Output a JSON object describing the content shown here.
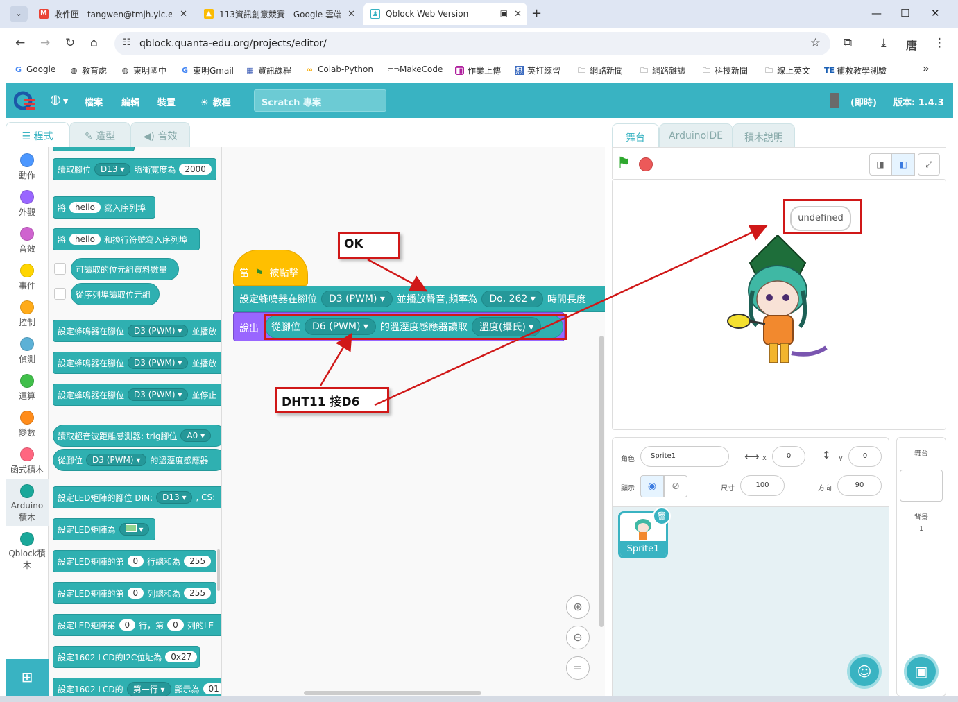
{
  "browser": {
    "tabs": [
      {
        "label": "收件匣 - tangwen@tmjh.ylc.ec"
      },
      {
        "label": "113資訊創意競賽 - Google 雲端"
      },
      {
        "label": "Qblock Web Version"
      }
    ],
    "url": "qblock.quanta-edu.org/projects/editor/",
    "profile": "唐",
    "bookmarks": [
      "Google",
      "教育處",
      "東明國中",
      "東明Gmail",
      "資訊課程",
      "Colab-Python",
      "MakeCode",
      "作業上傳",
      "英打練習",
      "網路新聞",
      "網路雜誌",
      "科技新聞",
      "線上英文",
      "補救教學測驗"
    ],
    "more": "»"
  },
  "qblock": {
    "menu": [
      "檔案",
      "編輯",
      "裝置",
      "教程"
    ],
    "project_name": "Scratch 專案",
    "mode": "(即時)",
    "version": "版本: 1.4.3",
    "editor_tabs": [
      "程式",
      "造型",
      "音效"
    ],
    "categories": [
      {
        "label": "動作",
        "color": "#4c97ff"
      },
      {
        "label": "外觀",
        "color": "#9966ff"
      },
      {
        "label": "音效",
        "color": "#cf63cf"
      },
      {
        "label": "事件",
        "color": "#ffd500"
      },
      {
        "label": "控制",
        "color": "#ffab19"
      },
      {
        "label": "偵測",
        "color": "#5cb1d6"
      },
      {
        "label": "運算",
        "color": "#40bf4a"
      },
      {
        "label": "變數",
        "color": "#ff8c1a"
      },
      {
        "label": "函式積木",
        "color": "#ff6680"
      },
      {
        "label": "Arduino積木",
        "color": "#1aa89a"
      },
      {
        "label": "Qblock積木",
        "color": "#1aa89a"
      }
    ],
    "palette": {
      "b1": {
        "pre": "讀取腳位",
        "pin": "D13",
        "mid": "脈衝寬度為",
        "val": "2000"
      },
      "b2": {
        "pre": "將",
        "pill": "hello",
        "post": "寫入序列埠"
      },
      "b3": {
        "pre": "將",
        "pill": "hello",
        "post": "和換行符號寫入序列埠"
      },
      "b4": {
        "text": "可讀取的位元組資料數量"
      },
      "b5": {
        "text": "從序列埠讀取位元組"
      },
      "b6": {
        "pre": "設定蜂鳴器在腳位",
        "pin": "D3 (PWM)",
        "post": "並播放"
      },
      "b7": {
        "pre": "設定蜂鳴器在腳位",
        "pin": "D3 (PWM)",
        "post": "並播放"
      },
      "b8": {
        "pre": "設定蜂鳴器在腳位",
        "pin": "D3 (PWM)",
        "post": "並停止"
      },
      "b9": {
        "pre": "讀取超音波距離感測器: trig腳位",
        "pin": "A0"
      },
      "b10": {
        "pre": "從腳位",
        "pin": "D3 (PWM)",
        "post": "的溫溼度感應器"
      },
      "b11": {
        "pre": "設定LED矩陣的腳位 DIN:",
        "pin": "D13",
        "post": ", CS:"
      },
      "b12": {
        "pre": "設定LED矩陣為"
      },
      "b13": {
        "pre": "設定LED矩陣的第",
        "v1": "0",
        "mid": "行總和為",
        "v2": "255"
      },
      "b14": {
        "pre": "設定LED矩陣的第",
        "v1": "0",
        "mid": "列總和為",
        "v2": "255"
      },
      "b15": {
        "pre": "設定LED矩陣第",
        "v1": "0",
        "mid": "行，第",
        "v2": "0",
        "post": "列的LE"
      },
      "b16": {
        "pre": "設定1602 LCD的I2C位址為",
        "val": "0x27"
      },
      "b17": {
        "pre": "設定1602 LCD的",
        "dd": "第一行",
        "post": "顯示為",
        "val": "01"
      }
    },
    "script": {
      "hat_pre": "當",
      "hat_post": "被點擊",
      "buzzer_pre": "設定蜂鳴器在腳位",
      "buzzer_pin": "D3 (PWM)",
      "buzzer_mid": "並播放聲音,頻率為",
      "buzzer_note": "Do, 262",
      "buzzer_post": "時間長度",
      "say": "說出",
      "dht_pre": "從腳位",
      "dht_pin": "D6 (PWM)",
      "dht_mid": "的溫溼度感應器讀取",
      "dht_sel": "溫度(攝氏)"
    },
    "annotations": {
      "ok": "OK",
      "dht": "DHT11 接D6"
    },
    "right_tabs": [
      "舞台",
      "ArduinoIDE",
      "積木說明"
    ],
    "speech": "undefined",
    "sprite": {
      "role_label": "角色",
      "name": "Sprite1",
      "x_label": "x",
      "x": "0",
      "y_label": "y",
      "y": "0",
      "show_label": "顯示",
      "size_label": "尺寸",
      "size": "100",
      "direction_label": "方向",
      "direction": "90",
      "thumb_name": "Sprite1"
    },
    "stage_col": {
      "title": "舞台",
      "backdrop_label": "背景",
      "backdrop_count": "1"
    }
  }
}
